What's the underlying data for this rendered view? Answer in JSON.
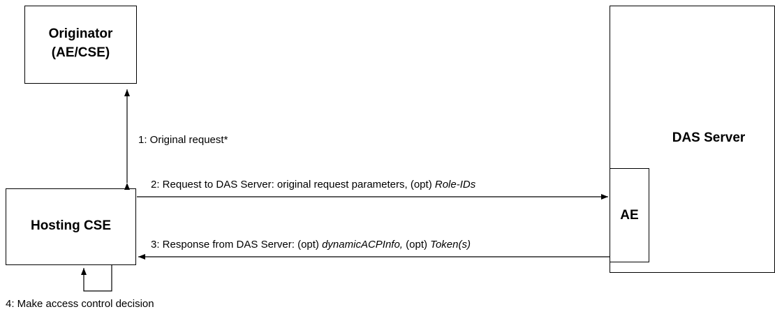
{
  "nodes": {
    "originator": {
      "line1": "Originator",
      "line2": "(AE/CSE)"
    },
    "hosting_cse": {
      "label": "Hosting CSE"
    },
    "das_server": {
      "label": "DAS Server"
    },
    "ae": {
      "label": "AE"
    }
  },
  "messages": {
    "m1": {
      "text": "1: Original request*"
    },
    "m2": {
      "prefix": "2: Request to DAS Server: original request parameters, (opt) ",
      "italic": "Role-IDs"
    },
    "m3": {
      "prefix": "3: Response from DAS Server: (opt) ",
      "italic1": "dynamicACPInfo,",
      "middle": " (opt) ",
      "italic2": "Token(s)"
    },
    "m4": {
      "text": "4: Make access control decision"
    }
  }
}
